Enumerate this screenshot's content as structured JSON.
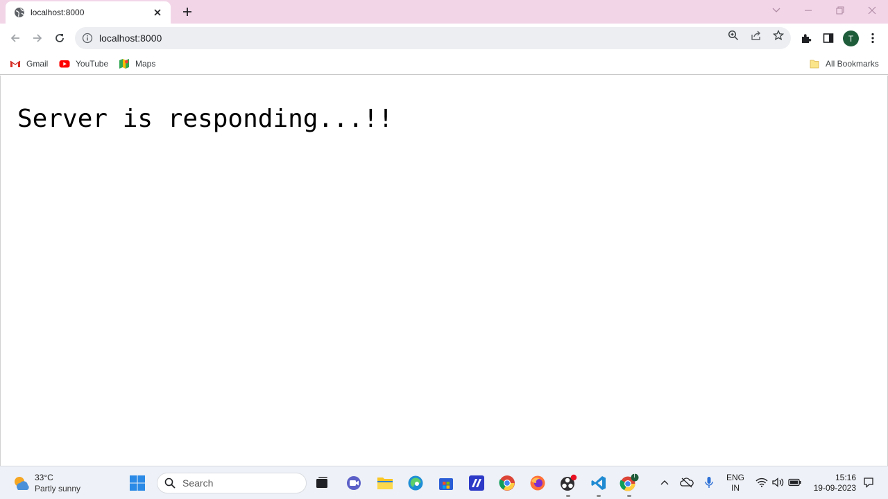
{
  "browser": {
    "tab": {
      "title": "localhost:8000"
    },
    "address": {
      "url": "localhost:8000"
    },
    "profile_initial": "T",
    "bookmarks": [
      {
        "label": "Gmail",
        "icon": "gmail-icon"
      },
      {
        "label": "YouTube",
        "icon": "youtube-icon"
      },
      {
        "label": "Maps",
        "icon": "maps-icon"
      }
    ],
    "all_bookmarks_label": "All Bookmarks"
  },
  "page": {
    "heading": "Server is responding...!!"
  },
  "taskbar": {
    "weather": {
      "temp": "33°C",
      "condition": "Partly sunny"
    },
    "search_label": "Search",
    "chrome_badge": "T",
    "language": {
      "line1": "ENG",
      "line2": "IN"
    },
    "clock": {
      "time": "15:16",
      "date": "19-09-2023"
    }
  },
  "colors": {
    "tabstrip_bg": "#f2d6e8",
    "omnibox_bg": "#eceef1",
    "avatar_bg": "#1e5c3a",
    "taskbar_bg": "#eef1f7"
  }
}
